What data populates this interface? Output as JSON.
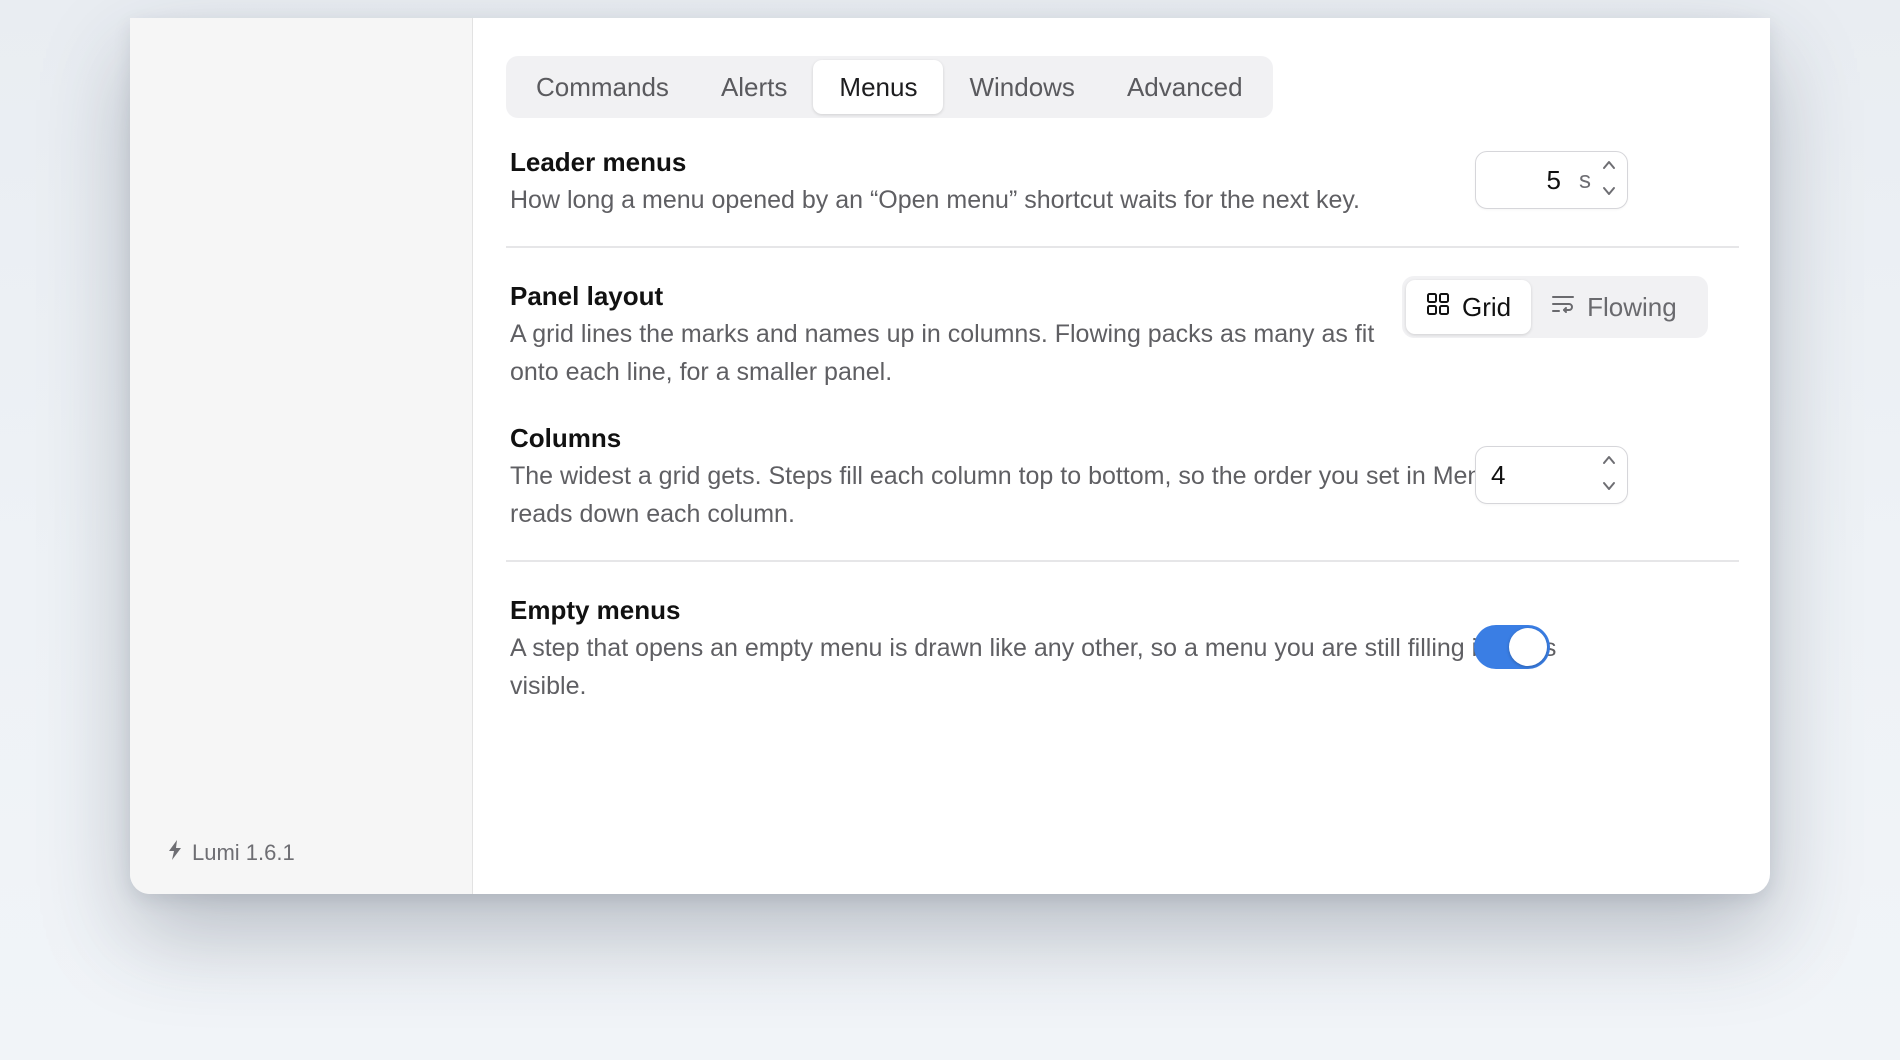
{
  "tabs": [
    {
      "label": "Commands",
      "active": false
    },
    {
      "label": "Alerts",
      "active": false
    },
    {
      "label": "Menus",
      "active": true
    },
    {
      "label": "Windows",
      "active": false
    },
    {
      "label": "Advanced",
      "active": false
    }
  ],
  "leader_menus": {
    "title": "Leader menus",
    "description": "How long a menu opened by an “Open menu” shortcut waits for the next key.",
    "value": "5",
    "unit": "s"
  },
  "panel_layout": {
    "title": "Panel layout",
    "description": "A grid lines the marks and names up in columns. Flowing packs as many as fit onto each line, for a smaller panel.",
    "options": [
      {
        "label": "Grid",
        "icon": "grid-icon",
        "selected": true
      },
      {
        "label": "Flowing",
        "icon": "text-wrap-icon",
        "selected": false
      }
    ]
  },
  "columns": {
    "title": "Columns",
    "description": "The widest a grid gets. Steps fill each column top to bottom, so the order you set in Menus reads down each column.",
    "value": "4"
  },
  "empty_menus": {
    "title": "Empty menus",
    "description": "A step that opens an empty menu is drawn like any other, so a menu you are still filling in stays visible.",
    "enabled": true
  },
  "sidebar": {
    "version_icon": "bolt-icon",
    "version": "Lumi 1.6.1"
  },
  "colors": {
    "accent": "#3a7ee4",
    "sidebar_bg": "#f6f6f6"
  }
}
